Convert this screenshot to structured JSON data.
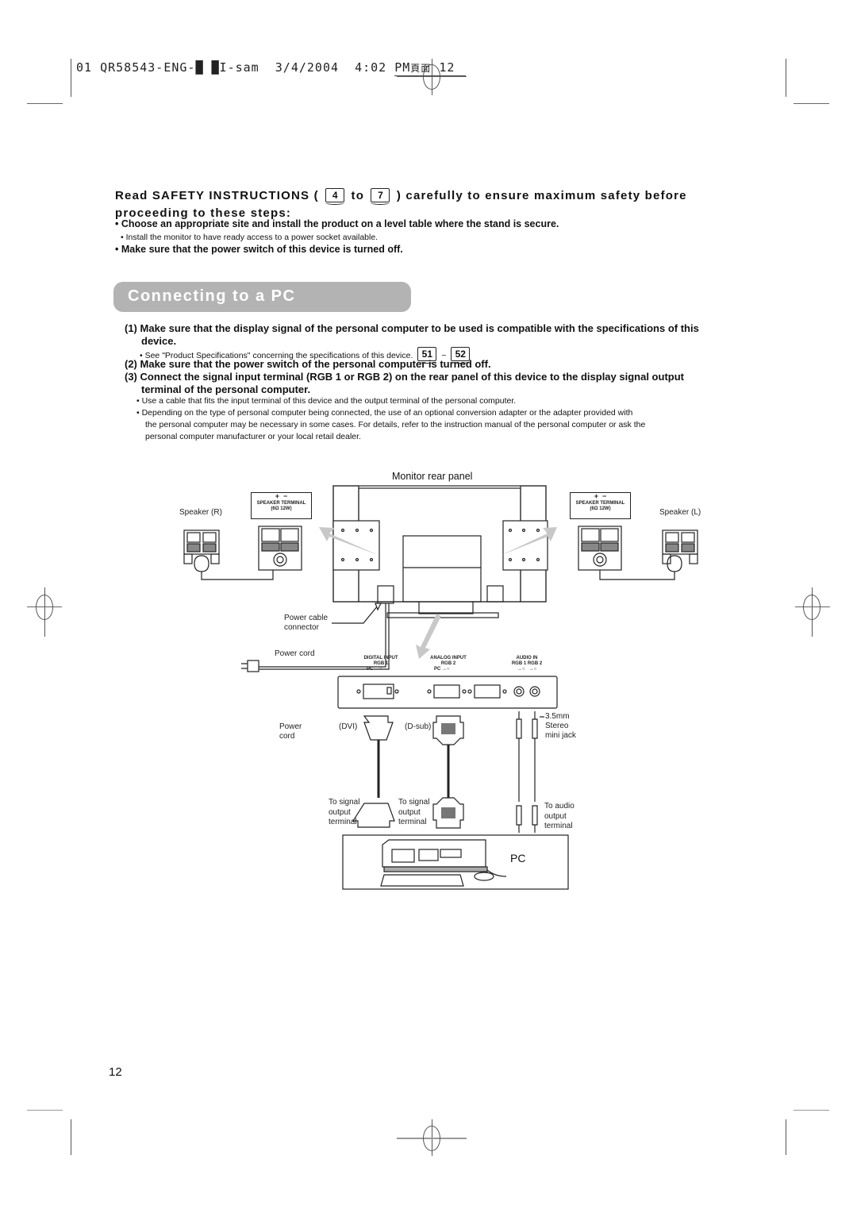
{
  "print_header": {
    "text": "01 QR58543-ENG-█ █I-sam  3/4/2004  4:02 PM",
    "cjk": "頁面",
    "page": " 12"
  },
  "safety": {
    "line_pre": "Read SAFETY INSTRUCTIONS (",
    "ref_from": "4",
    "to": "to",
    "ref_to": "7",
    "line_post": ") carefully to ensure maximum safety before",
    "line2": "proceeding to these steps:",
    "bullet1": "• Choose an appropriate site and install the product on a level table where the stand is secure.",
    "sub1": "• Install the monitor to have ready access to a power socket available.",
    "bullet2": "• Make sure that the power switch of this device is turned off."
  },
  "section_title": "Connecting to a PC",
  "steps": [
    {
      "num": "(1)",
      "text": "Make sure that the display signal of the personal computer to be used is compatible with the specifications of this",
      "cont": "device."
    },
    {
      "num": "(2)",
      "text": "Make sure that the power switch of the personal computer is turned off."
    },
    {
      "num": "(3)",
      "text": "Connect the signal input terminal (RGB 1 or RGB 2) on the rear panel of this device to the display signal output",
      "cont": "terminal of the personal computer."
    }
  ],
  "step1_note": {
    "text": "• See \"Product Specifications\" concerning the specifications of this device.",
    "ref_a": "51",
    "sep": "~",
    "ref_b": "52"
  },
  "step3_notes": [
    "• Use a cable that fits the input terminal of this device and the output terminal of the personal computer.",
    "• Depending on the type of personal computer being connected, the use of an optional conversion adapter or the adapter provided with",
    "the personal computer may be necessary in some cases. For details, refer to the instruction manual of the personal computer or ask the",
    "personal computer manufacturer or your local retail dealer."
  ],
  "diagram": {
    "title": "Monitor rear panel",
    "speaker_r": "Speaker (R)",
    "speaker_l": "Speaker (L)",
    "speaker_terminal": "SPEAKER TERMINAL",
    "speaker_spec": "(6Ω 12W)",
    "plus": "+",
    "minus": "−",
    "power_cable_connector": [
      "Power cable",
      "connector"
    ],
    "power_cord_top": "Power cord",
    "power_cord_bottom": [
      "Power",
      "cord"
    ],
    "digital_input": [
      "DIGITAL INPUT",
      "RGB 1"
    ],
    "analog_input": [
      "ANALOG INPUT",
      "RGB 2"
    ],
    "audio_in": [
      "AUDIO IN",
      "RGB 1  RGB 2"
    ],
    "pc_in": "PC →○",
    "in_sym": "→○",
    "dvi": "(DVI)",
    "dsub": "(D-sub)",
    "jack": [
      "3.5mm",
      "Stereo",
      "mini jack"
    ],
    "to_signal_1": [
      "To signal",
      "output",
      "terminal"
    ],
    "to_signal_2": [
      "To signal",
      "output",
      "terminal"
    ],
    "to_audio": [
      "To audio",
      "output",
      "terminal"
    ],
    "pc": "PC"
  },
  "page_number": "12"
}
